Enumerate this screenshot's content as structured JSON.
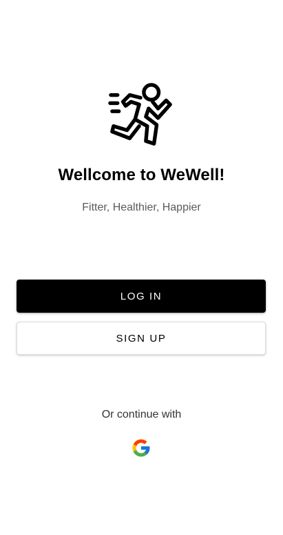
{
  "welcome": {
    "title": "Wellcome to WeWell!",
    "tagline": "Fitter, Healthier, Happier"
  },
  "actions": {
    "login_label": "LOG IN",
    "signup_label": "SIGN UP"
  },
  "social": {
    "prompt": "Or continue with",
    "provider_icon": "google-icon"
  },
  "icons": {
    "logo": "running-person-icon"
  },
  "colors": {
    "primary": "#000000",
    "background": "#ffffff",
    "subtitle": "#5a5a5a"
  }
}
